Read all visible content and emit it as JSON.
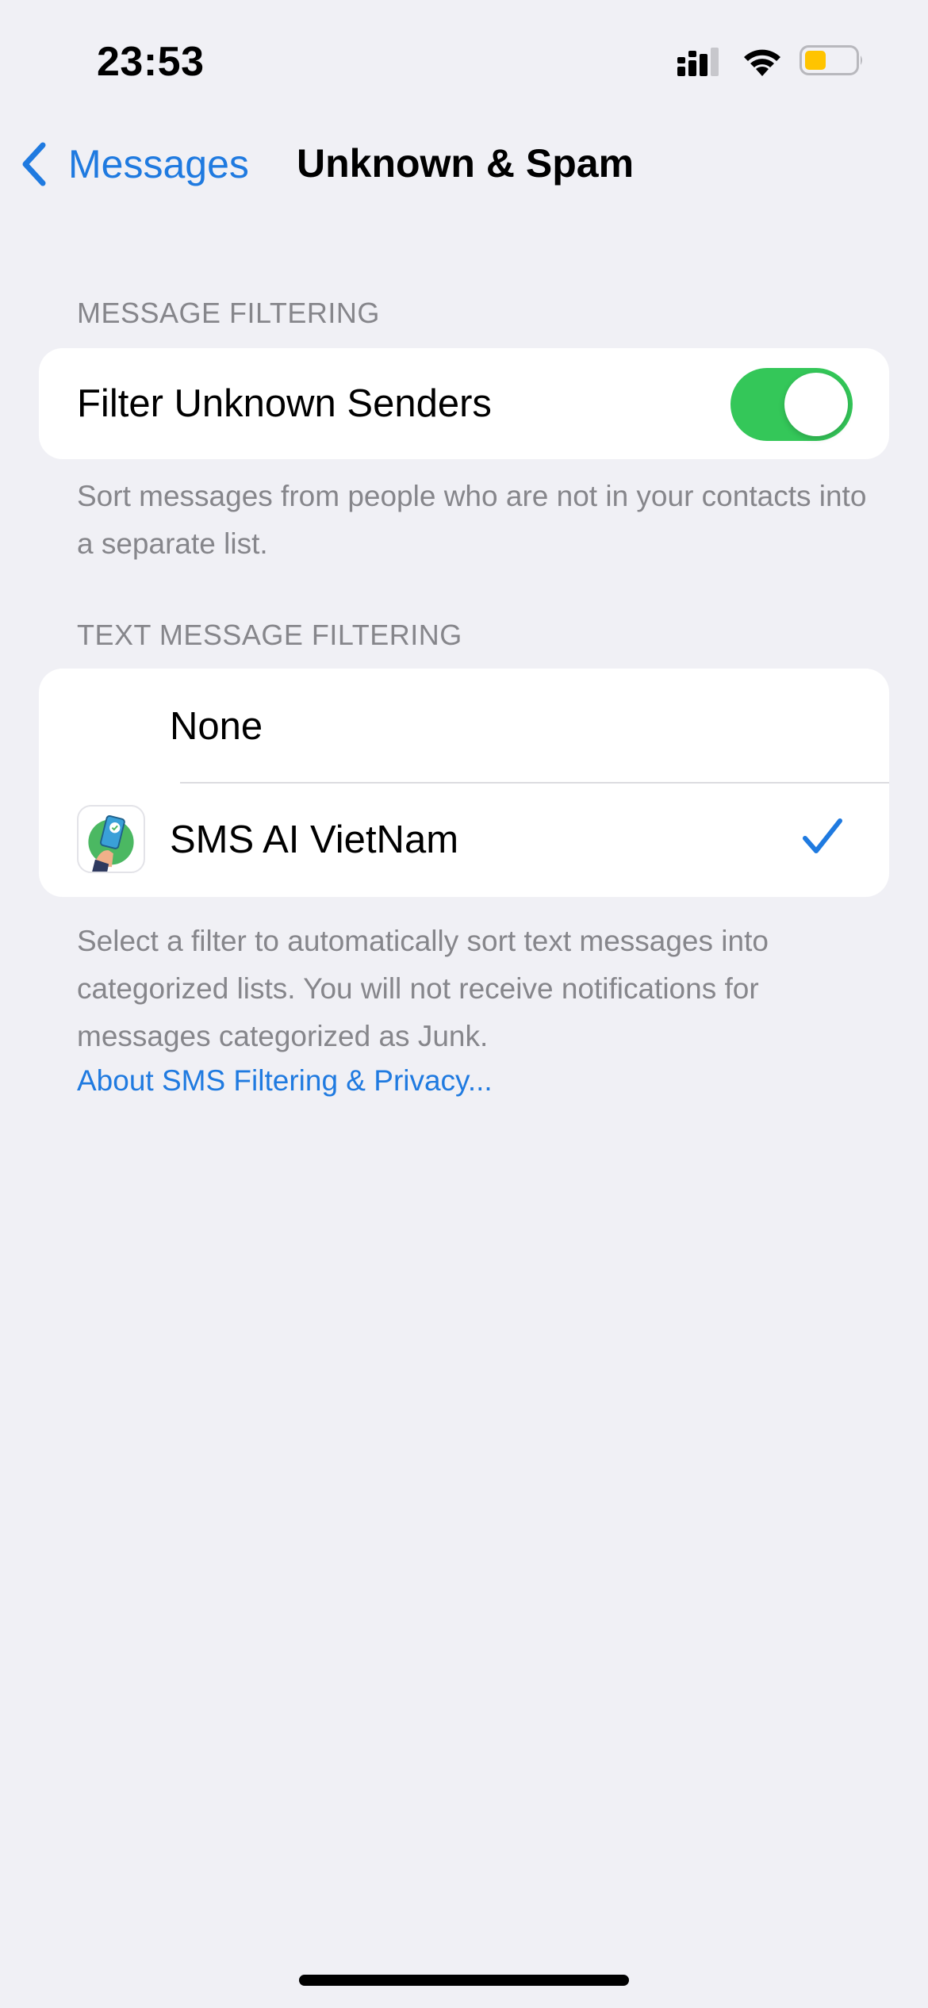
{
  "status_bar": {
    "time": "23:53",
    "icons": [
      "cellular-signal-icon",
      "wifi-icon",
      "battery-icon"
    ],
    "battery_color": "#ffc400"
  },
  "nav": {
    "back_label": "Messages",
    "title": "Unknown & Spam"
  },
  "message_filtering": {
    "header": "MESSAGE FILTERING",
    "filter_unknown_label": "Filter Unknown Senders",
    "filter_unknown_on": true,
    "footnote": "Sort messages from people who are not in your contacts into a separate list."
  },
  "text_message_filtering": {
    "header": "TEXT MESSAGE FILTERING",
    "options": [
      {
        "label": "None",
        "selected": false
      },
      {
        "label": "SMS AI  VietNam",
        "selected": true,
        "icon": "sms-ai-app-icon"
      }
    ],
    "footnote": "Select a filter to automatically sort text messages into categorized lists. You will not receive notifications for messages categorized as Junk.",
    "link": "About SMS Filtering & Privacy..."
  },
  "colors": {
    "accent": "#1f7ae0",
    "toggle_on": "#34c759",
    "background": "#f0f0f5"
  }
}
